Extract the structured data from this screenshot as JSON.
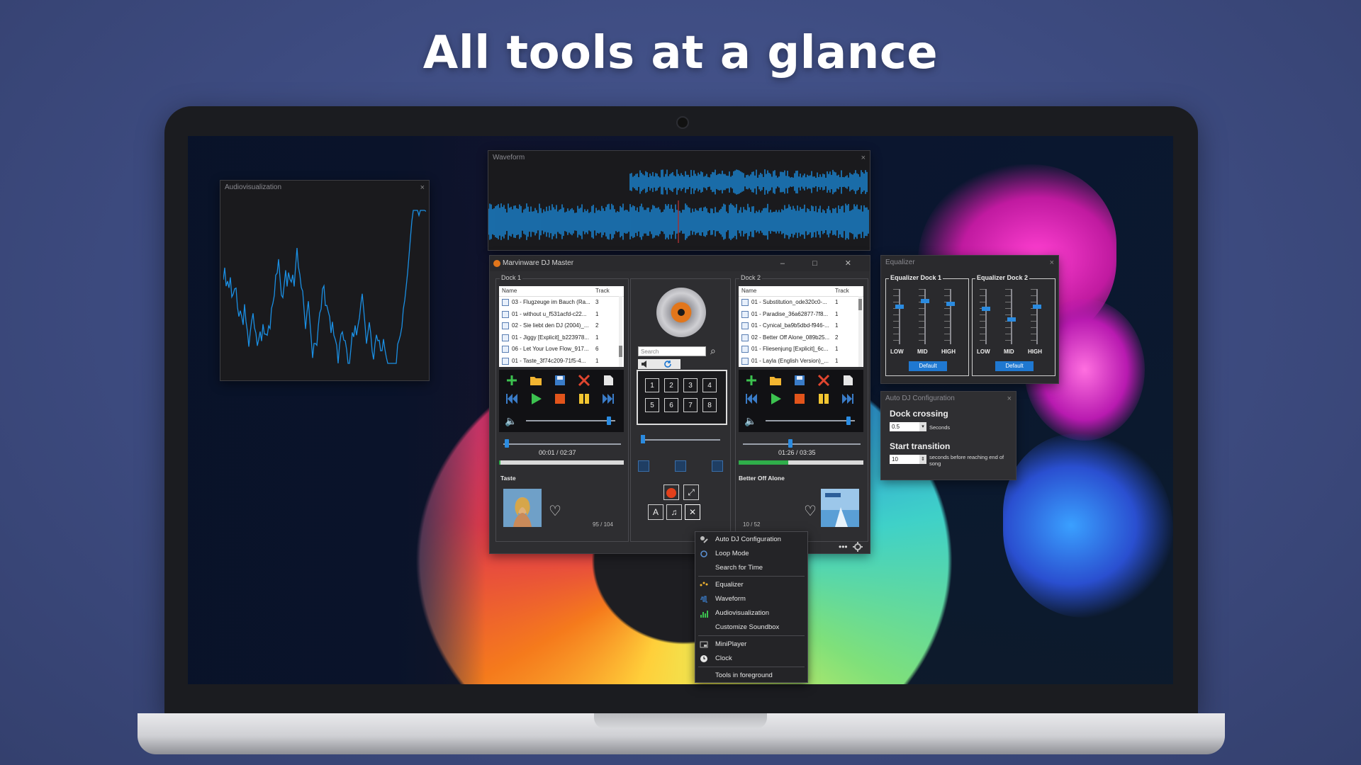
{
  "headline": "All tools at a glance",
  "audiovisualization": {
    "title": "Audiovisualization",
    "close": "×"
  },
  "waveform": {
    "title": "Waveform",
    "close": "×"
  },
  "main": {
    "title": "Marvinware DJ Master",
    "window_controls": "– □ ✕",
    "dock1": {
      "label": "Dock 1",
      "col_name": "Name",
      "col_track": "Track",
      "tracks": [
        {
          "name": "03 - Flugzeuge im Bauch (Ra...",
          "track": "3"
        },
        {
          "name": "01 - without u_f531acfd-c22...",
          "track": "1"
        },
        {
          "name": "02 - Sie liebt den DJ (2004)_...",
          "track": "2"
        },
        {
          "name": "01 - Jiggy [Explicit]_b223978...",
          "track": "1"
        },
        {
          "name": "06 - Let Your Love Flow_917...",
          "track": "6"
        },
        {
          "name": "01 - Taste_3f74c209-71f5-4...",
          "track": "1"
        }
      ],
      "time": "00:01 / 02:37",
      "progress": 0.01,
      "volume": 0.95,
      "position": 0.01,
      "song": "Taste",
      "count": "95 / 104"
    },
    "dock2": {
      "label": "Dock 2",
      "col_name": "Name",
      "col_track": "Track",
      "tracks": [
        {
          "name": "01 - Substitution_ode320c0-...",
          "track": "1"
        },
        {
          "name": "01 - Paradise_36a62877-7f8...",
          "track": "1"
        },
        {
          "name": "01 - Cynical_ba9b5dbd-f946-...",
          "track": "1"
        },
        {
          "name": "02 - Better Off Alone_089b25...",
          "track": "2"
        },
        {
          "name": "01 - Fliesenjung [Explicit]_6c...",
          "track": "1"
        },
        {
          "name": "01 - Layla (English Version)_...",
          "track": "1"
        }
      ],
      "time": "01:26 / 03:35",
      "progress": 0.4,
      "volume": 0.95,
      "position": 0.4,
      "song": "Better Off Alone",
      "count": "10 / 52"
    },
    "center": {
      "search_placeholder": "Search",
      "pads": [
        "1",
        "2",
        "3",
        "4",
        "5",
        "6",
        "7",
        "8"
      ]
    },
    "bottom_dots": "•••"
  },
  "context_menu": {
    "items": [
      {
        "label": "Auto DJ Configuration",
        "icon": "auto-dj-icon"
      },
      {
        "label": "Loop Mode",
        "icon": "loop-icon"
      },
      {
        "label": "Search for Time",
        "icon": ""
      },
      {
        "label": "Equalizer",
        "icon": "equalizer-icon"
      },
      {
        "label": "Waveform",
        "icon": "waveform-icon"
      },
      {
        "label": "Audiovisualization",
        "icon": "audiovisualization-icon"
      },
      {
        "label": "Customize Soundbox",
        "icon": ""
      },
      {
        "label": "MiniPlayer",
        "icon": "miniplayer-icon"
      },
      {
        "label": "Clock",
        "icon": "clock-icon"
      },
      {
        "label": "Tools in foreground",
        "icon": ""
      }
    ]
  },
  "equalizer": {
    "title": "Equalizer",
    "close": "×",
    "groups": [
      {
        "label": "Equalizer Dock 1",
        "bands": [
          "LOW",
          "MID",
          "HIGH"
        ],
        "levels": [
          0.3,
          0.2,
          0.25
        ],
        "button": "Default"
      },
      {
        "label": "Equalizer Dock 2",
        "bands": [
          "LOW",
          "MID",
          "HIGH"
        ],
        "levels": [
          0.35,
          0.55,
          0.3
        ],
        "button": "Default"
      }
    ]
  },
  "auto_dj": {
    "title": "Auto DJ Configuration",
    "close": "×",
    "dock_crossing_label": "Dock crossing",
    "dock_crossing_value": "0.5",
    "dock_crossing_unit": "Seconds",
    "start_transition_label": "Start transition",
    "start_transition_value": "10",
    "start_transition_unit": "seconds before reaching end of song"
  },
  "colors": {
    "accent": "#2b8be0",
    "brand_orange": "#e2761b",
    "progress_green": "#2fae4a",
    "waveform_blue": "#1a8fe3"
  }
}
